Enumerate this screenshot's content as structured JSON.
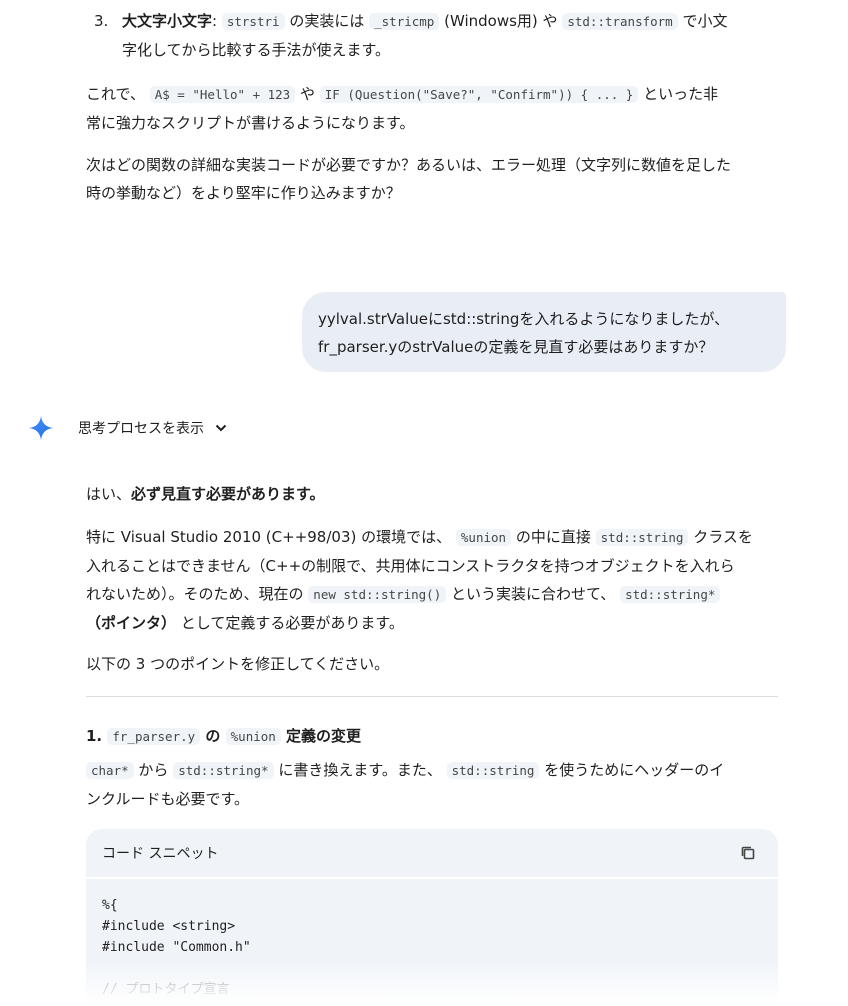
{
  "list_item3": {
    "number": "3.",
    "term": "大文字小文字",
    "colon": ":",
    "code1": "strstri",
    "t1": "の実装には",
    "code2": "_stricmp",
    "t2": "(Windows用) や",
    "code3": "std::transform",
    "t3": "で小文",
    "line2": "字化してから比較する手法が使えます。"
  },
  "para_script": {
    "t1": "これで、",
    "code1": "A$ = \"Hello\" + 123",
    "t2": "や",
    "code2": "IF (Question(\"Save?\", \"Confirm\")) { ... }",
    "t3": "といった非",
    "line2": "常に強力なスクリプトが書けるようになります。"
  },
  "para_next": {
    "line1": "次はどの関数の詳細な実装コードが必要ですか？あるいは、エラー処理（文字列に数値を足した",
    "line2": "時の挙動など）をより堅牢に作り込みますか？"
  },
  "user_message": {
    "line1": "yylval.strValueにstd::stringを入れるようになりましたが、",
    "line2": "fr_parser.yのstrValueの定義を見直す必要はありますか？"
  },
  "thinking": {
    "label": "思考プロセスを表示"
  },
  "answer": {
    "intro_plain": "はい、",
    "intro_bold": "必ず見直す必要があります。",
    "p2": {
      "t1": "特に Visual Studio 2010 (C++98/03) の環境では、",
      "code1": "%union",
      "t2": "の中に直接",
      "code2": "std::string",
      "t3": "クラスを",
      "line2": "入れることはできません（C++の制限で、共用体にコンストラクタを持つオブジェクトを入れら",
      "t4": "れないため）。そのため、現在の",
      "code3": "new std::string()",
      "t5": "という実装に合わせて、",
      "code4": "std::string*",
      "bold": "（ポインタ）",
      "t6": "として定義する必要があります。"
    },
    "p3": "以下の 3 つのポイントを修正してください。",
    "heading": {
      "num": "1.",
      "code1": "fr_parser.y",
      "t1": "の",
      "code2": "%union",
      "t2": "定義の変更"
    },
    "p4": {
      "code1": "char*",
      "t1": "から",
      "code2": "std::string*",
      "t2": "に書き換えます。また、",
      "code3": "std::string",
      "t3": "を使うためにヘッダーのイ",
      "line2": "ンクルードも必要です。"
    }
  },
  "snippet": {
    "title": "コード スニペット",
    "lines": [
      "%{",
      "#include <string>",
      "#include \"Common.h\"",
      "",
      "// プロトタイプ宣言"
    ]
  },
  "colors": {
    "accent_blue": "#4285f4",
    "bubble": "#e9eef6",
    "code_bg": "#f0f4f9"
  }
}
